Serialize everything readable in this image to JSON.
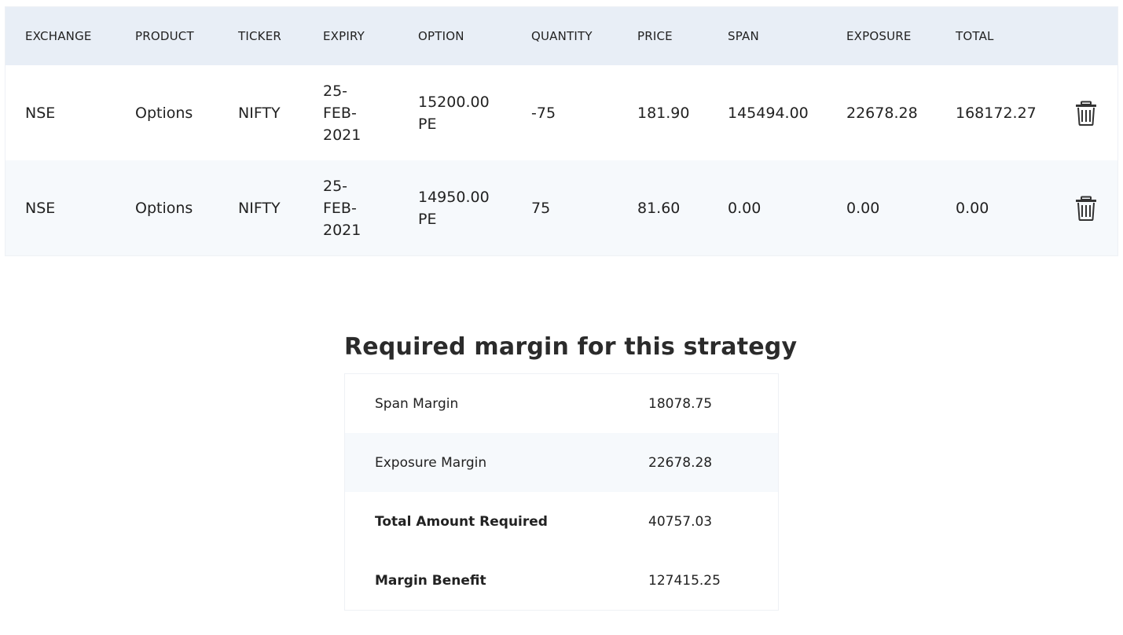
{
  "positions": {
    "headers": [
      "EXCHANGE",
      "PRODUCT",
      "TICKER",
      "EXPIRY",
      "OPTION",
      "QUANTITY",
      "PRICE",
      "SPAN",
      "EXPOSURE",
      "TOTAL"
    ],
    "rows": [
      {
        "exchange": "NSE",
        "product": "Options",
        "ticker": "NIFTY",
        "expiry": "25-FEB-2021",
        "option": "15200.00 PE",
        "quantity": "-75",
        "price": "181.90",
        "span": "145494.00",
        "exposure": "22678.28",
        "total": "168172.27",
        "delete_icon": "trash-icon"
      },
      {
        "exchange": "NSE",
        "product": "Options",
        "ticker": "NIFTY",
        "expiry": "25-FEB-2021",
        "option": "14950.00 PE",
        "quantity": "75",
        "price": "81.60",
        "span": "0.00",
        "exposure": "0.00",
        "total": "0.00",
        "delete_icon": "trash-icon"
      }
    ]
  },
  "margin": {
    "title": "Required margin for this strategy",
    "rows": [
      {
        "label": "Span Margin",
        "value": "18078.75"
      },
      {
        "label": "Exposure Margin",
        "value": "22678.28"
      },
      {
        "label": "Total Amount Required",
        "value": "40757.03"
      },
      {
        "label": "Margin Benefit",
        "value": "127415.25"
      }
    ]
  },
  "colors": {
    "header_bg": "#e8eef6",
    "alt_row_bg": "#f6f9fc",
    "text": "#222222"
  }
}
